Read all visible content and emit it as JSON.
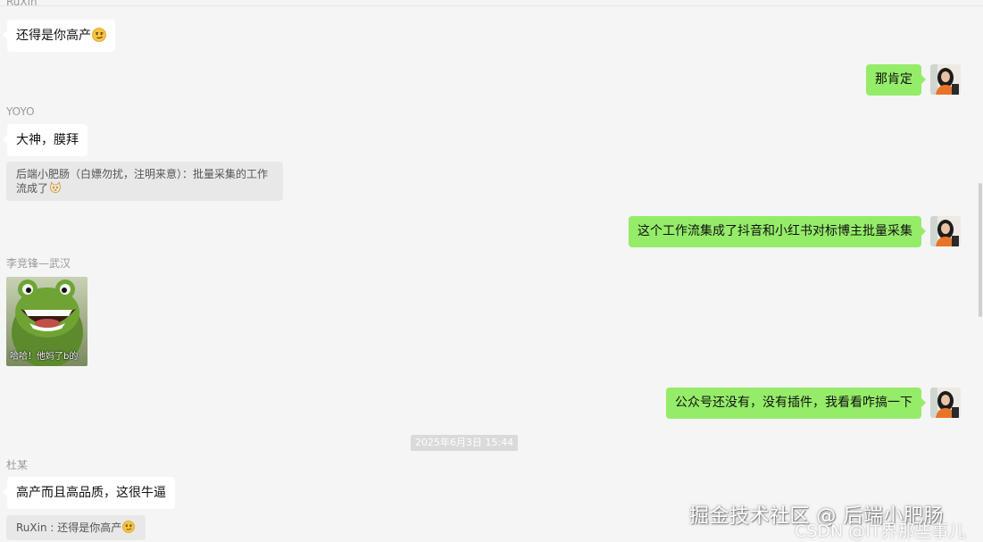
{
  "colors": {
    "background": "#f5f5f5",
    "incoming_bubble": "#ffffff",
    "outgoing_bubble": "#95ec69",
    "quote_bg": "#e8e8e8",
    "timestamp_bg": "#dadada"
  },
  "messages": {
    "m1": {
      "sender": "RuXin",
      "text": "还得是你高产",
      "emoji": "smirk-emoji"
    },
    "m2": {
      "text": "那肯定"
    },
    "m3": {
      "sender": "YOYO",
      "text": "大神，膜拜"
    },
    "m3_quote": {
      "line1": "后端小肥肠（白嫖勿扰，注明来意）：批量采集的工作",
      "line2": "流成了",
      "emoji": "cat-emoji"
    },
    "m4": {
      "text": "这个工作流集成了抖音和小红书对标博主批量采集"
    },
    "m5": {
      "sender": "李竞锋—武汉",
      "sticker_caption": "哈哈！他妈了b的"
    },
    "m6": {
      "text": "公众号还没有，没有插件，我看看咋搞一下"
    },
    "timestamp": "2025年6月3日 15:44",
    "m7": {
      "sender": "杜某",
      "text": "高产而且高品质，这很牛逼"
    },
    "m7_quote": {
      "text": "RuXin : 还得是你高产",
      "emoji": "smirk-emoji"
    }
  },
  "watermark": {
    "main": "掘金技术社区 @ 后端小肥肠",
    "sub": "CSDN @IT界那些事儿"
  }
}
